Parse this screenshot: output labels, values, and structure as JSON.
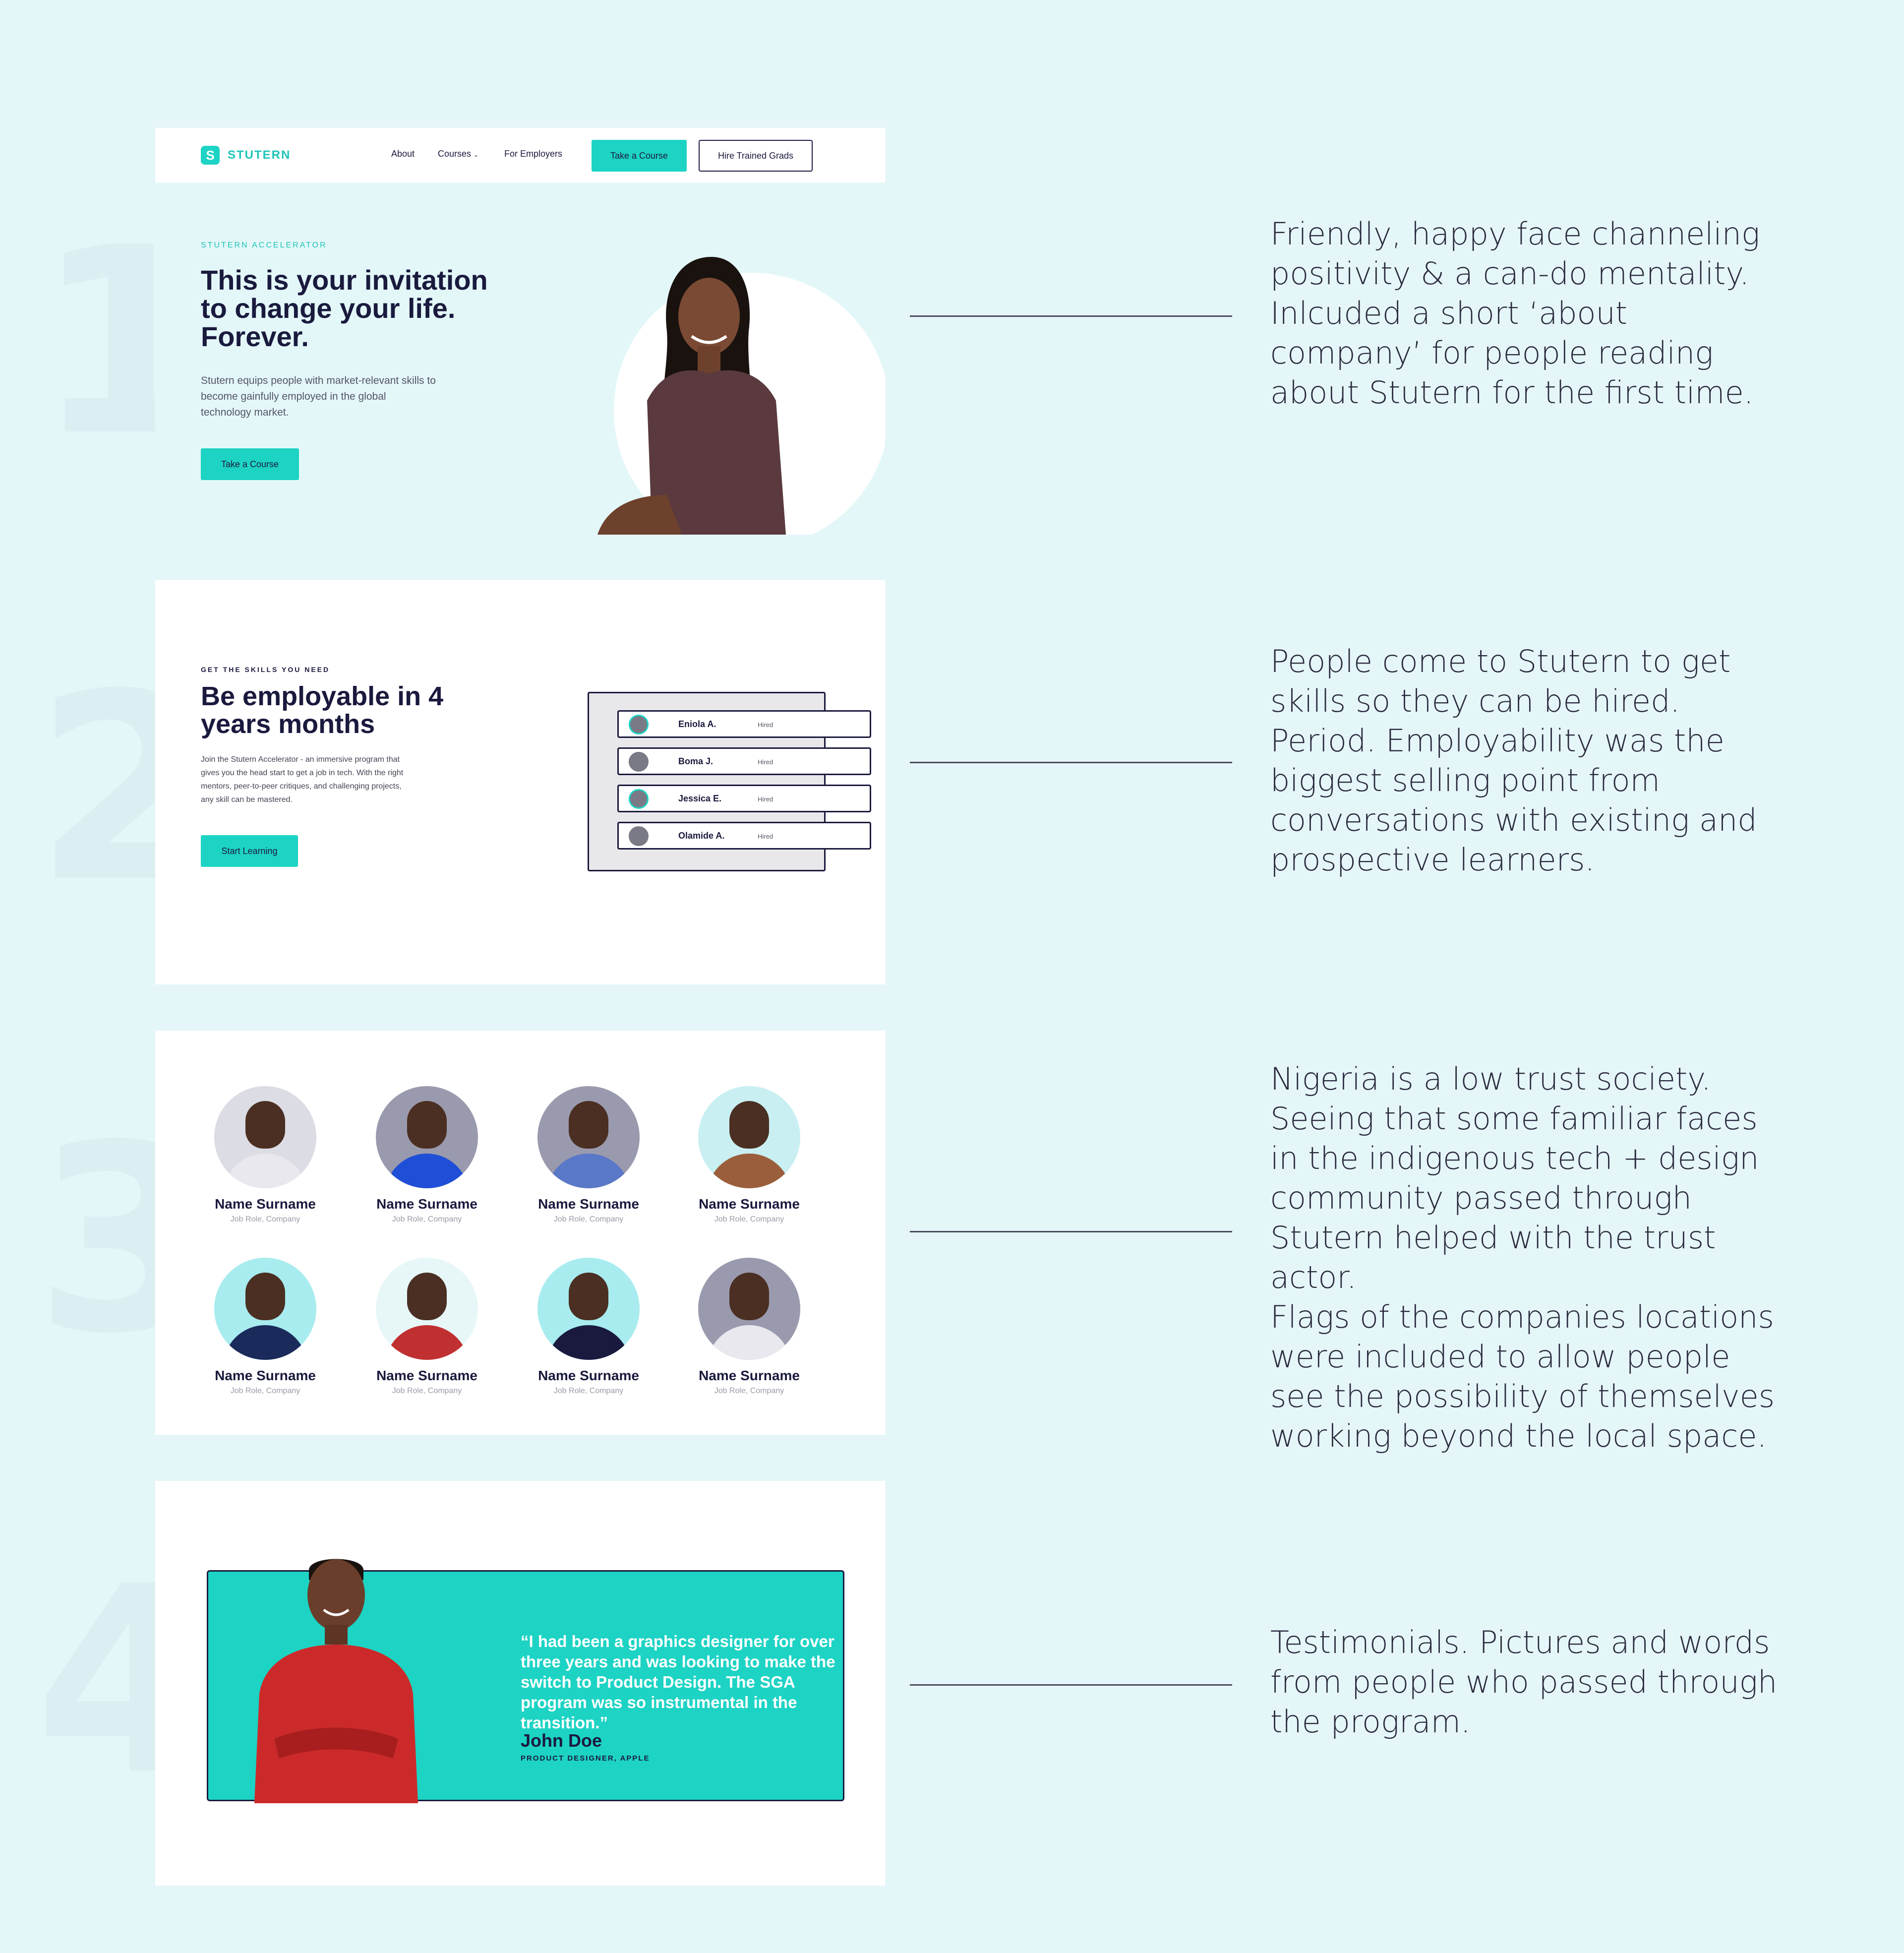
{
  "section_numbers": [
    "1",
    "2",
    "3",
    "4"
  ],
  "colors": {
    "accent": "#1dd3c4",
    "ink": "#1a1a3e",
    "page_bg": "#e5f6f9"
  },
  "hero": {
    "logo_text": "STUTERN",
    "nav": {
      "about": "About",
      "courses": "Courses",
      "employers": "For Employers",
      "take_course": "Take a Course",
      "hire": "Hire Trained Grads"
    },
    "eyebrow": "STUTERN  ACCELERATOR",
    "heading": "This is your invitation to change your life. Forever.",
    "body": "Stutern equips people with market-relevant skills to become gainfully employed in the global technology market.",
    "cta": "Take a Course"
  },
  "skills": {
    "eyebrow": "GET THE SKILLS YOU NEED",
    "heading": "Be employable in 4 years months",
    "body": "Join the Stutern Accelerator - an immersive program that gives you the head start to get a job in tech. With the right mentors, peer-to-peer critiques, and challenging projects, any skill can be mastered.",
    "cta": "Start Learning",
    "hires": [
      {
        "name": "Eniola A.",
        "status": "Hired"
      },
      {
        "name": "Boma J.",
        "status": "Hired"
      },
      {
        "name": "Jessica E.",
        "status": "Hired"
      },
      {
        "name": "Olamide A.",
        "status": "Hired"
      }
    ]
  },
  "people": [
    {
      "name": "Name Surname",
      "role": "Job Role, Company",
      "bg": "#dcdce4",
      "shirt": "#e8e8ee"
    },
    {
      "name": "Name Surname",
      "role": "Job Role, Company",
      "bg": "#9a9aae",
      "shirt": "#1f4fd6"
    },
    {
      "name": "Name Surname",
      "role": "Job Role, Company",
      "bg": "#9a9aae",
      "shirt": "#5a78c8"
    },
    {
      "name": "Name Surname",
      "role": "Job Role, Company",
      "bg": "#c9eff2",
      "shirt": "#9b5e3c"
    },
    {
      "name": "Name Surname",
      "role": "Job Role, Company",
      "bg": "#a8ecef",
      "shirt": "#1a2a5a"
    },
    {
      "name": "Name Surname",
      "role": "Job Role, Company",
      "bg": "#e7f7f8",
      "shirt": "#c03030"
    },
    {
      "name": "Name Surname",
      "role": "Job Role, Company",
      "bg": "#a8ecef",
      "shirt": "#1a1a3e"
    },
    {
      "name": "Name Surname",
      "role": "Job Role, Company",
      "bg": "#9a9aae",
      "shirt": "#e8e8ee"
    }
  ],
  "testimonial": {
    "quote": "“I had been a graphics designer for over three years and was looking to make the switch to Product Design. The SGA program was so instrumental in the transition.”",
    "name": "John Doe",
    "role": "PRODUCT DESIGNER, APPLE"
  },
  "notes": [
    "Friendly, happy face channeling positivity & a can-do mentality. Inlcuded a short ‘about company’ for people reading about Stutern for the first time.",
    "People come to Stutern to get skills so they can be hired. Period. Employability was the biggest selling point from conversations with existing and prospective learners.",
    "Nigeria is a low trust society. Seeing that some familiar faces in the indigenous tech + design community passed through Stutern helped with the trust actor.",
    "Flags of the companies locations were included to allow people see the possibility of themselves working beyond the local space.",
    "Testimonials. Pictures and words from people who passed through the program."
  ]
}
